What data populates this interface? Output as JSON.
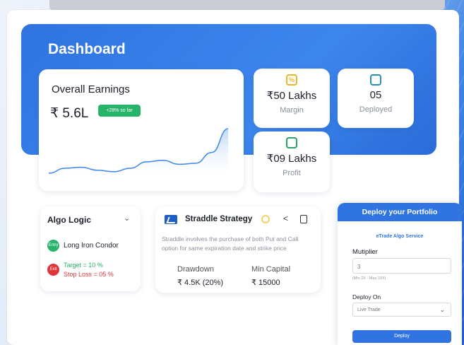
{
  "dashboard": {
    "title": "Dashboard"
  },
  "earnings": {
    "label": "Overall Earnings",
    "value": "₹ 5.6L",
    "badge": "+28% so far",
    "trend": [
      0.1,
      0.2,
      0.22,
      0.16,
      0.13,
      0.2,
      0.33,
      0.36,
      0.28,
      0.3,
      0.52,
      1.0
    ]
  },
  "stats": {
    "margin": {
      "icon": "percent-icon",
      "value": "₹50 Lakhs",
      "label": "Margin"
    },
    "deployed": {
      "icon": "box-icon",
      "value": "05",
      "label": "Deployed"
    },
    "profit": {
      "icon": "chart-icon",
      "value": "₹09 Lakhs",
      "label": "Profit"
    }
  },
  "algo": {
    "title": "Algo Logic",
    "entry_pill": "Entry",
    "entry_label": "Long Iron Condor",
    "exit_pill": "Exit",
    "target": "Target = 10 %",
    "stop_loss": "Stop Loss = 05 %"
  },
  "strategy": {
    "name": "Straddle Strategy",
    "description": "Straddle involves the purchase of both Put and Call option for same expiration date and strike price",
    "drawdown_label": "Drawdown",
    "drawdown_value": "₹ 4.5K (20%)",
    "capital_label": "Min Capital",
    "capital_value": "₹ 15000"
  },
  "deploy": {
    "header": "Deploy your Portfolio",
    "service": "eTrade Algo Service",
    "multiplier_label": "Mutiplier",
    "multiplier_value": "3",
    "multiplier_hint": "(Min 2X - Max 10X)",
    "deploy_on_label": "Deploy On",
    "deploy_on_value": "Live Trade",
    "button": "Deploy"
  }
}
